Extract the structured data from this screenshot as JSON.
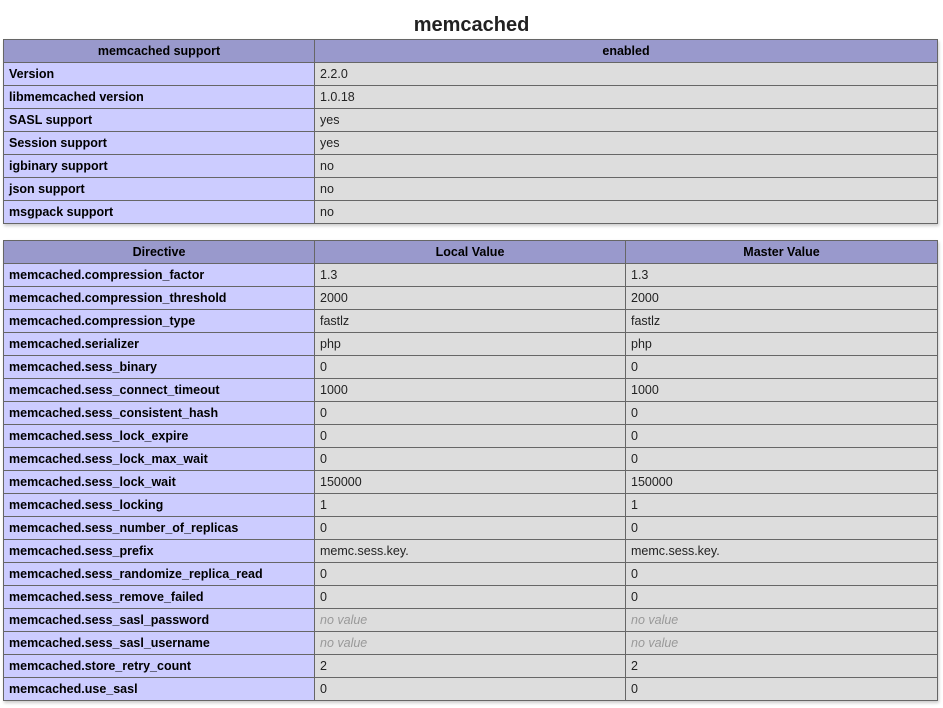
{
  "title": "memcached",
  "support_table": {
    "headers": [
      "memcached support",
      "enabled"
    ],
    "rows": [
      {
        "name": "Version",
        "value": "2.2.0"
      },
      {
        "name": "libmemcached version",
        "value": "1.0.18"
      },
      {
        "name": "SASL support",
        "value": "yes"
      },
      {
        "name": "Session support",
        "value": "yes"
      },
      {
        "name": "igbinary support",
        "value": "no"
      },
      {
        "name": "json support",
        "value": "no"
      },
      {
        "name": "msgpack support",
        "value": "no"
      }
    ]
  },
  "directive_table": {
    "headers": [
      "Directive",
      "Local Value",
      "Master Value"
    ],
    "rows": [
      {
        "name": "memcached.compression_factor",
        "local": "1.3",
        "master": "1.3"
      },
      {
        "name": "memcached.compression_threshold",
        "local": "2000",
        "master": "2000"
      },
      {
        "name": "memcached.compression_type",
        "local": "fastlz",
        "master": "fastlz"
      },
      {
        "name": "memcached.serializer",
        "local": "php",
        "master": "php"
      },
      {
        "name": "memcached.sess_binary",
        "local": "0",
        "master": "0"
      },
      {
        "name": "memcached.sess_connect_timeout",
        "local": "1000",
        "master": "1000"
      },
      {
        "name": "memcached.sess_consistent_hash",
        "local": "0",
        "master": "0"
      },
      {
        "name": "memcached.sess_lock_expire",
        "local": "0",
        "master": "0"
      },
      {
        "name": "memcached.sess_lock_max_wait",
        "local": "0",
        "master": "0"
      },
      {
        "name": "memcached.sess_lock_wait",
        "local": "150000",
        "master": "150000"
      },
      {
        "name": "memcached.sess_locking",
        "local": "1",
        "master": "1"
      },
      {
        "name": "memcached.sess_number_of_replicas",
        "local": "0",
        "master": "0"
      },
      {
        "name": "memcached.sess_prefix",
        "local": "memc.sess.key.",
        "master": "memc.sess.key."
      },
      {
        "name": "memcached.sess_randomize_replica_read",
        "local": "0",
        "master": "0"
      },
      {
        "name": "memcached.sess_remove_failed",
        "local": "0",
        "master": "0"
      },
      {
        "name": "memcached.sess_sasl_password",
        "local": "no value",
        "master": "no value",
        "no_value": true
      },
      {
        "name": "memcached.sess_sasl_username",
        "local": "no value",
        "master": "no value",
        "no_value": true
      },
      {
        "name": "memcached.store_retry_count",
        "local": "2",
        "master": "2"
      },
      {
        "name": "memcached.use_sasl",
        "local": "0",
        "master": "0"
      }
    ]
  },
  "colors": {
    "header_bg": "#9999cc",
    "name_cell_bg": "#ccccff",
    "value_cell_bg": "#dddddd",
    "no_value_text": "#999999"
  }
}
